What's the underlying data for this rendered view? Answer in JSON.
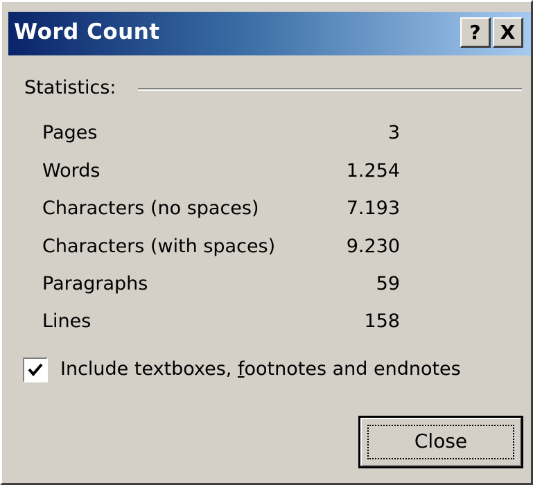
{
  "window": {
    "title": "Word Count",
    "help_label": "?",
    "close_label": "X"
  },
  "statistics": {
    "label": "Statistics:",
    "rows": [
      {
        "label": "Pages",
        "value": "3"
      },
      {
        "label": "Words",
        "value": "1.254"
      },
      {
        "label": "Characters (no spaces)",
        "value": "7.193"
      },
      {
        "label": "Characters (with spaces)",
        "value": "9.230"
      },
      {
        "label": "Paragraphs",
        "value": "59"
      },
      {
        "label": "Lines",
        "value": "158"
      }
    ]
  },
  "include_checkbox": {
    "checked": true,
    "label_before": "Include textboxes, ",
    "label_accel": "f",
    "label_after": "ootnotes and endnotes"
  },
  "buttons": {
    "close_label": "Close"
  },
  "colors": {
    "titlebar_start": "#0a246a",
    "titlebar_end": "#a6caf0",
    "face": "#d4d0c8"
  }
}
